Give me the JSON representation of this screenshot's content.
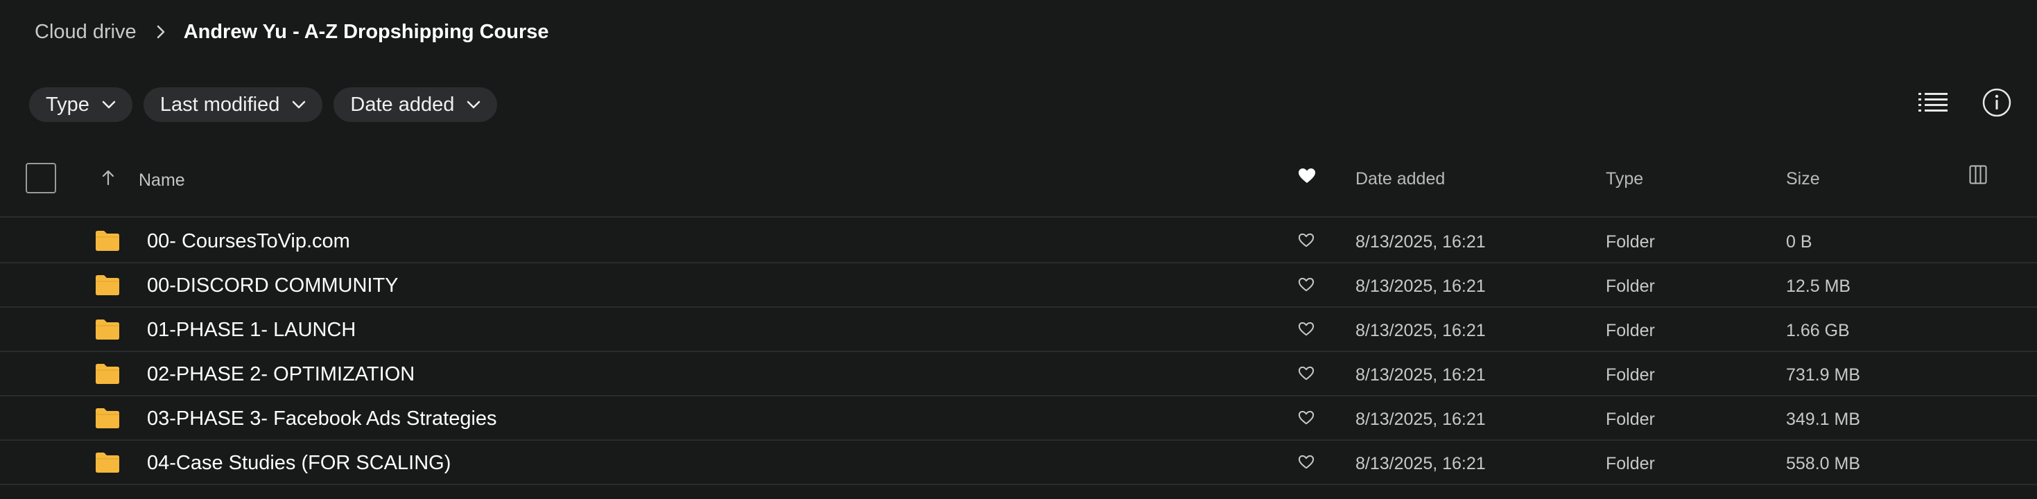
{
  "breadcrumb": {
    "root": "Cloud drive",
    "current": "Andrew Yu - A-Z Dropshipping Course"
  },
  "filters": [
    {
      "label": "Type"
    },
    {
      "label": "Last modified"
    },
    {
      "label": "Date added"
    }
  ],
  "icons": {
    "chevron": "chevron-down-icon",
    "list_view": "list-view-icon",
    "info": "info-icon",
    "folder": "folder-icon",
    "heart": "heart-icon",
    "columns": "columns-icon"
  },
  "colors": {
    "background": "#181919",
    "chip": "#2c2d2e",
    "folder": "#f5b83c",
    "divider": "#2a2b2c"
  },
  "table": {
    "columns": {
      "name": "Name",
      "date_added": "Date added",
      "type": "Type",
      "size": "Size"
    },
    "rows": [
      {
        "name": "00- CoursesToVip.com",
        "date": "8/13/2025, 16:21",
        "type": "Folder",
        "size": "0 B"
      },
      {
        "name": "00-DISCORD COMMUNITY",
        "date": "8/13/2025, 16:21",
        "type": "Folder",
        "size": "12.5 MB"
      },
      {
        "name": "01-PHASE 1- LAUNCH",
        "date": "8/13/2025, 16:21",
        "type": "Folder",
        "size": "1.66 GB"
      },
      {
        "name": "02-PHASE 2- OPTIMIZATION",
        "date": "8/13/2025, 16:21",
        "type": "Folder",
        "size": "731.9 MB"
      },
      {
        "name": "03-PHASE 3- Facebook Ads Strategies",
        "date": "8/13/2025, 16:21",
        "type": "Folder",
        "size": "349.1 MB"
      },
      {
        "name": "04-Case Studies (FOR SCALING)",
        "date": "8/13/2025, 16:21",
        "type": "Folder",
        "size": "558.0 MB"
      }
    ]
  }
}
